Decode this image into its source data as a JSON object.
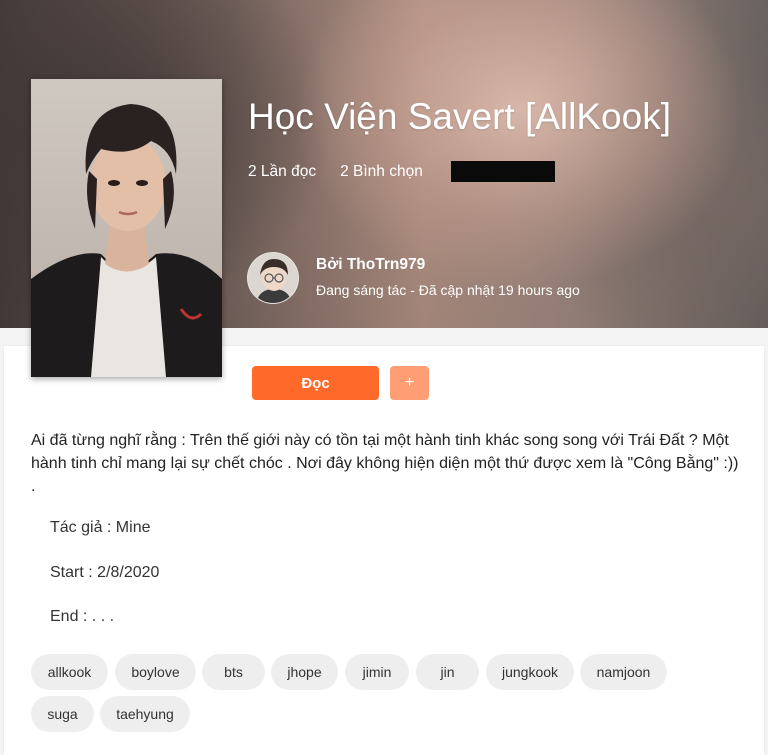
{
  "story": {
    "title": "Học Viện Savert [AllKook]",
    "reads": "2 Lần đọc",
    "votes": "2 Bình chọn"
  },
  "author": {
    "by_line": "Bởi ThoTrn979",
    "status": "Đang sáng tác - Đã cập nhật 19 hours ago"
  },
  "actions": {
    "read_label": "Đọc",
    "add_label": "+"
  },
  "description": {
    "text": "Ai đã từng nghĩ rằng : Trên thế giới này có tồn tại một hành tinh khác song song với Trái Đất ? Một hành tinh chỉ mang lại sự chết chóc . Nơi đây không hiện diện một thứ được xem là \"Công Bằng\" :)) .",
    "author_line": "Tác giả : Mine",
    "start_line": "Start : 2/8/2020",
    "end_line": "End : . . ."
  },
  "tags": [
    "allkook",
    "boylove",
    "bts",
    "jhope",
    "jimin",
    "jin",
    "jungkook",
    "namjoon",
    "suga",
    "taehyung"
  ],
  "colors": {
    "read_button": "#ff6a2b",
    "add_button": "#ff9e74",
    "tag_bg": "#eeeeee"
  }
}
